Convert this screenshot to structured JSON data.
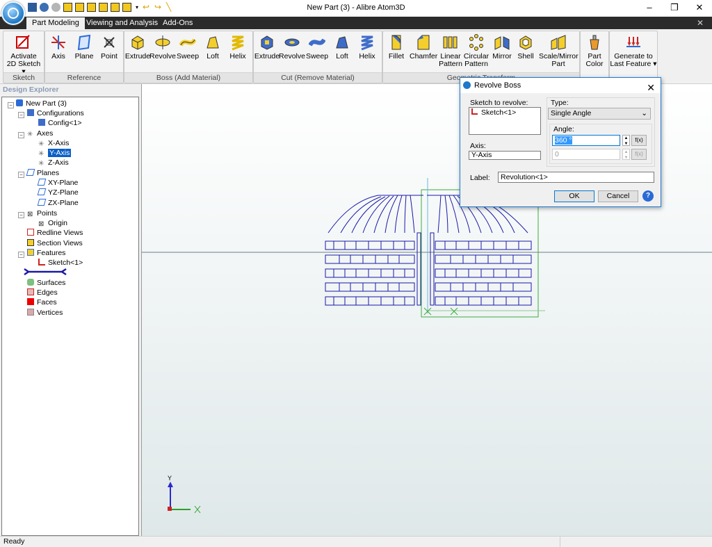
{
  "window": {
    "title": "New Part (3) - Alibre Atom3D",
    "minimize": "–",
    "maximize": "❐",
    "close": "✕"
  },
  "tabs": [
    {
      "label": "Part Modeling"
    },
    {
      "label": "Viewing and Analysis"
    },
    {
      "label": "Add-Ons"
    }
  ],
  "ribbon": {
    "sketch": {
      "label": "Sketch",
      "activate_line1": "Activate",
      "activate_line2": "2D Sketch"
    },
    "reference": {
      "label": "Reference",
      "axis": "Axis",
      "plane": "Plane",
      "point": "Point"
    },
    "boss": {
      "label": "Boss (Add Material)",
      "extrude": "Extrude",
      "revolve": "Revolve",
      "sweep": "Sweep",
      "loft": "Loft",
      "helix": "Helix"
    },
    "cut": {
      "label": "Cut (Remove Material)",
      "extrude": "Extrude",
      "revolve": "Revolve",
      "sweep": "Sweep",
      "loft": "Loft",
      "helix": "Helix"
    },
    "geometric": {
      "label": "Geometric Transform",
      "fillet": "Fillet",
      "chamfer": "Chamfer",
      "linear1": "Linear",
      "linear2": "Pattern",
      "circular1": "Circular",
      "circular2": "Pattern",
      "mirror": "Mirror",
      "shell": "Shell",
      "scale1": "Scale/Mirror",
      "scale2": "Part"
    },
    "color": {
      "line1": "Part",
      "line2": "Color"
    },
    "generate": {
      "line1": "Generate to",
      "line2": "Last Feature"
    }
  },
  "explorer": {
    "title": "Design Explorer",
    "nodes": {
      "root": "New Part (3)",
      "configurations": "Configurations",
      "config1": "Config<1>",
      "axes": "Axes",
      "xaxis": "X-Axis",
      "yaxis": "Y-Axis",
      "zaxis": "Z-Axis",
      "planes": "Planes",
      "xy": "XY-Plane",
      "yz": "YZ-Plane",
      "zx": "ZX-Plane",
      "points": "Points",
      "origin": "Origin",
      "redline": "Redline Views",
      "section": "Section Views",
      "features": "Features",
      "sketch1": "Sketch<1>",
      "surfaces": "Surfaces",
      "edges": "Edges",
      "faces": "Faces",
      "vertices": "Vertices"
    }
  },
  "dialog": {
    "title": "Revolve Boss",
    "sketch_label": "Sketch to revolve:",
    "sketch_item": "Sketch<1>",
    "type_label": "Type:",
    "type_value": "Single Angle",
    "angle_label": "Angle:",
    "angle_value": "360 °",
    "angle2_value": "0",
    "fx": "f(x)",
    "axis_label": "Axis:",
    "axis_value": "Y-Axis",
    "label_label": "Label:",
    "label_value": "Revolution<1>",
    "ok": "OK",
    "cancel": "Cancel",
    "help": "?"
  },
  "triad": {
    "y": "Y"
  },
  "status": {
    "text": "Ready"
  }
}
